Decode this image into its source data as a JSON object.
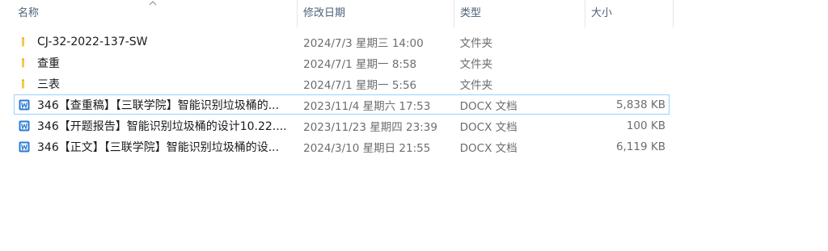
{
  "columns": {
    "name": "名称",
    "date": "修改日期",
    "type": "类型",
    "size": "大小"
  },
  "files": [
    {
      "name": "CJ-32-2022-137-SW",
      "date": "2024/7/3 星期三 14:00",
      "type": "文件夹",
      "size": "",
      "icon": "folder-icon"
    },
    {
      "name": "查重",
      "date": "2024/7/1 星期一 8:58",
      "type": "文件夹",
      "size": "",
      "icon": "folder-icon"
    },
    {
      "name": "三表",
      "date": "2024/7/1 星期一 5:56",
      "type": "文件夹",
      "size": "",
      "icon": "folder-icon"
    },
    {
      "name": "346【查重稿】【三联学院】智能识别垃圾桶的...",
      "date": "2023/11/4 星期六 17:53",
      "type": "DOCX 文档",
      "size": "5,838 KB",
      "icon": "docx-icon"
    },
    {
      "name": "346【开题报告】智能识别垃圾桶的设计10.22....",
      "date": "2023/11/23 星期四 23:39",
      "type": "DOCX 文档",
      "size": "100 KB",
      "icon": "docx-icon"
    },
    {
      "name": "346【正文】【三联学院】智能识别垃圾桶的设...",
      "date": "2024/3/10 星期日 21:55",
      "type": "DOCX 文档",
      "size": "6,119 KB",
      "icon": "docx-icon"
    }
  ],
  "colors": {
    "header_text": "#4c607a",
    "detail_text": "#6d6d6d",
    "focus_border": "#99d1ff",
    "folder": "#f8c94a",
    "docx": "#2b7cd3"
  }
}
